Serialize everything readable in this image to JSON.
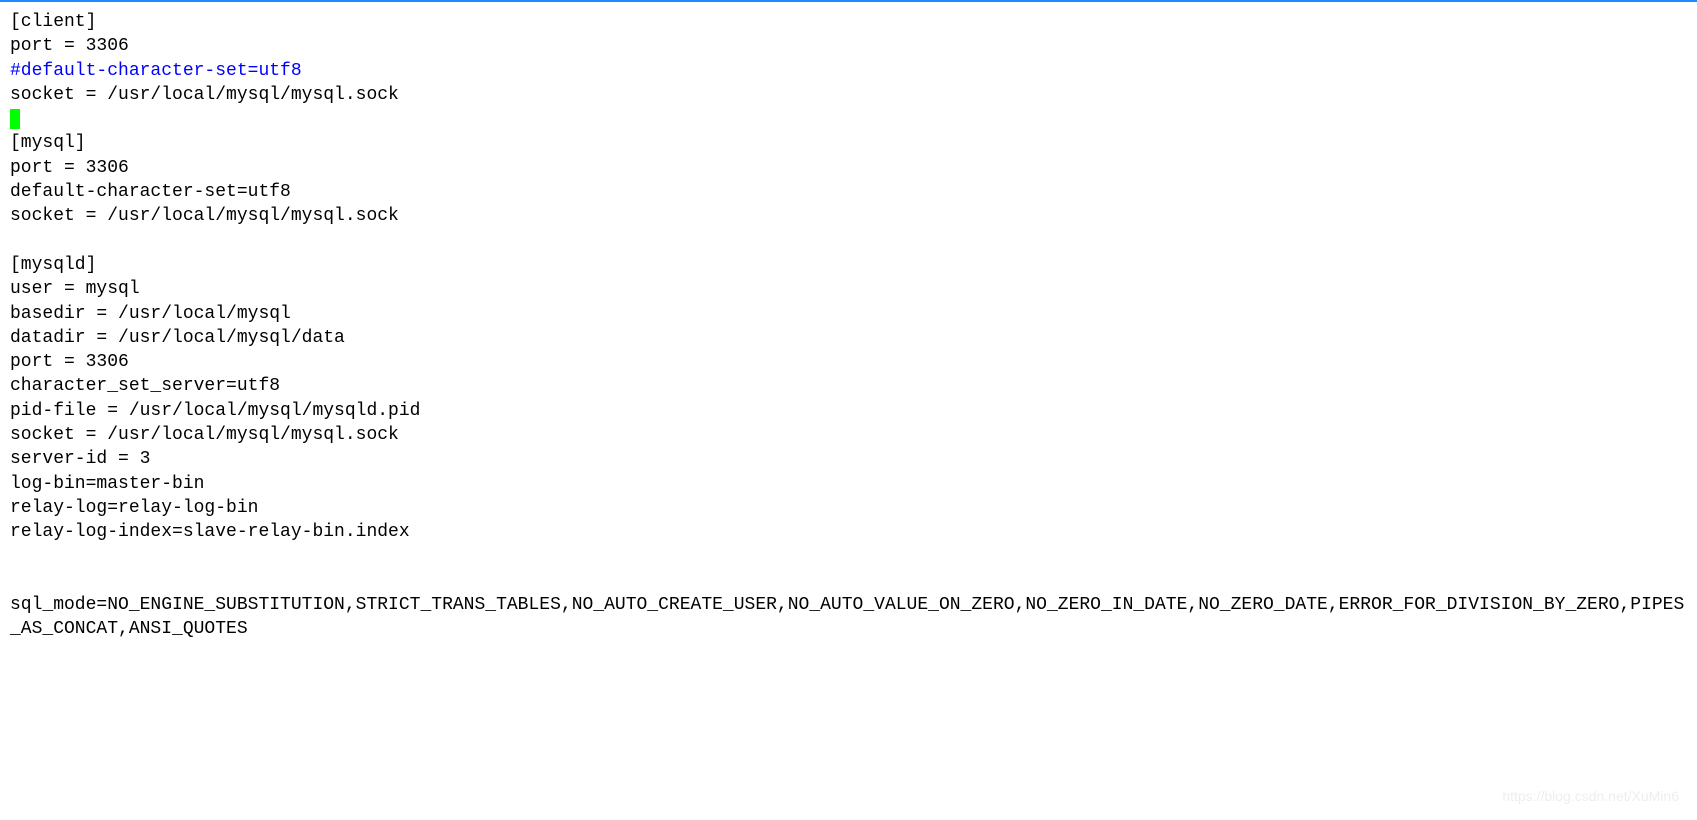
{
  "lines": {
    "0": "[client]",
    "1": "port = 3306",
    "2": "#default-character-set=utf8",
    "3": "socket = /usr/local/mysql/mysql.sock",
    "5": "[mysql]",
    "6": "port = 3306",
    "7": "default-character-set=utf8",
    "8": "socket = /usr/local/mysql/mysql.sock",
    "10": "[mysqld]",
    "11": "user = mysql",
    "12": "basedir = /usr/local/mysql",
    "13": "datadir = /usr/local/mysql/data",
    "14": "port = 3306",
    "15": "character_set_server=utf8",
    "16": "pid-file = /usr/local/mysql/mysqld.pid",
    "17": "socket = /usr/local/mysql/mysql.sock",
    "18": "server-id = 3",
    "19": "log-bin=master-bin",
    "20": "relay-log=relay-log-bin",
    "21": "relay-log-index=slave-relay-bin.index",
    "24": "sql_mode=NO_ENGINE_SUBSTITUTION,STRICT_TRANS_TABLES,NO_AUTO_CREATE_USER,NO_AUTO_VALUE_ON_ZERO,NO_ZERO_IN_DATE,NO_ZERO_DATE,ERROR_FOR_DIVISION_BY_ZERO,PIPES_AS_CONCAT,ANSI_QUOTES"
  },
  "watermark": "https://blog.csdn.net/XuMin6"
}
